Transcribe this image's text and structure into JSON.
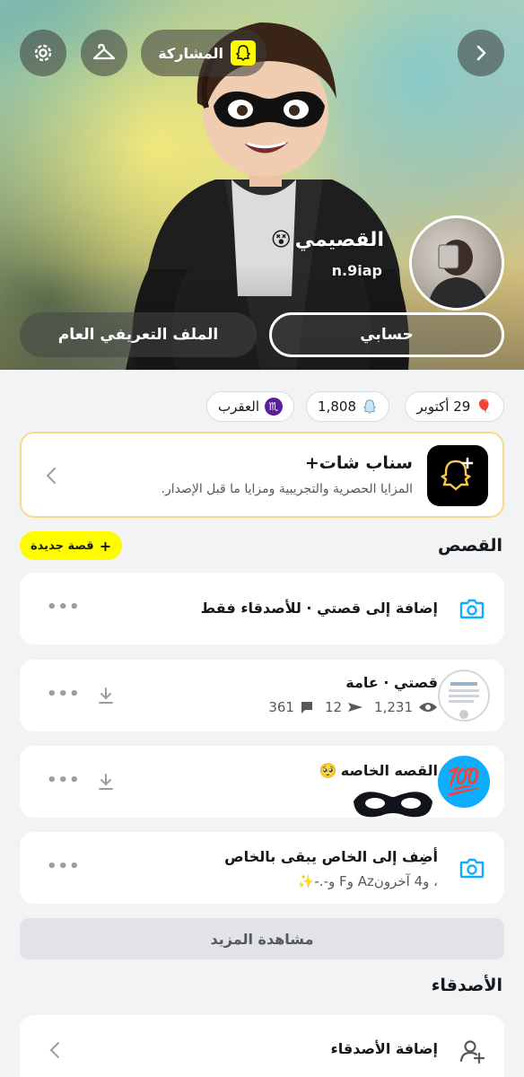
{
  "header": {
    "share_label": "المشاركة",
    "display_name": "القصيمي",
    "name_emoji": "😵",
    "username": "n.9iap",
    "tabs": [
      {
        "label": "حسابي",
        "active": true
      },
      {
        "label": "الملف التعريفي العام",
        "active": false
      }
    ]
  },
  "badges": {
    "birthday": {
      "icon": "🎈",
      "text": "29 أكتوبر"
    },
    "score": {
      "icon": "ghost-icon",
      "text": "1,808"
    },
    "zodiac": {
      "icon": "♏",
      "text": "العقرب"
    }
  },
  "snapchat_plus": {
    "title": "سناب شات+",
    "subtitle": "المزايا الحصرية والتجريبية ومزايا ما قبل الإصدار."
  },
  "stories": {
    "section_title": "القصص",
    "new_story_label": "قصة جديدة",
    "items": [
      {
        "title": "إضافة إلى قصتي · للأصدقاء فقط"
      },
      {
        "title": "قصتي · عامة",
        "views": "1,231",
        "shares": "12",
        "replies": "361"
      },
      {
        "title": "القصه الخاصه",
        "emoji": "🥺",
        "thumb_emoji": "💯"
      },
      {
        "title": "أضِف إلى الخاص يبقى بالخاص",
        "subtitle": "، و4 آخرونAz وF و-.-✨"
      }
    ],
    "see_more_label": "مشاهدة المزيد"
  },
  "friends": {
    "section_title": "الأصدقاء",
    "add_friends_label": "إضافة الأصدقاء"
  },
  "colors": {
    "snap_yellow": "#fffc00",
    "accent_blue": "#0fadff",
    "page_bg": "#f2f3f5"
  }
}
